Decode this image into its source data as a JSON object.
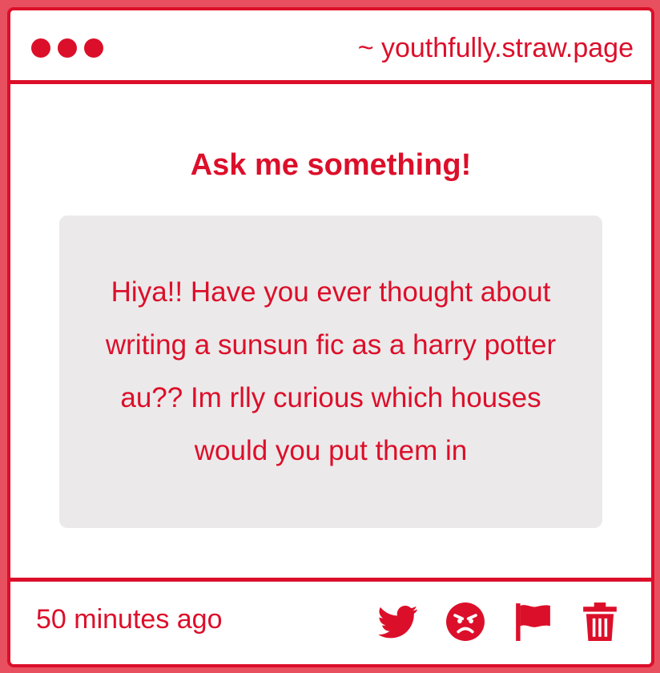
{
  "window": {
    "url": "~ youthfully.straw.page"
  },
  "main": {
    "heading": "Ask me something!",
    "question": "Hiya!! Have you ever thought about writing a sunsun fic as a harry potter au?? Im rlly curious which houses would you put them in"
  },
  "footer": {
    "timestamp": "50 minutes ago",
    "actions": [
      {
        "icon": "twitter-icon"
      },
      {
        "icon": "angry-face-icon"
      },
      {
        "icon": "flag-icon"
      },
      {
        "icon": "trash-icon"
      }
    ]
  },
  "colors": {
    "accent": "#dc0f2a",
    "background": "#e8505f",
    "card": "#ece9ea"
  }
}
